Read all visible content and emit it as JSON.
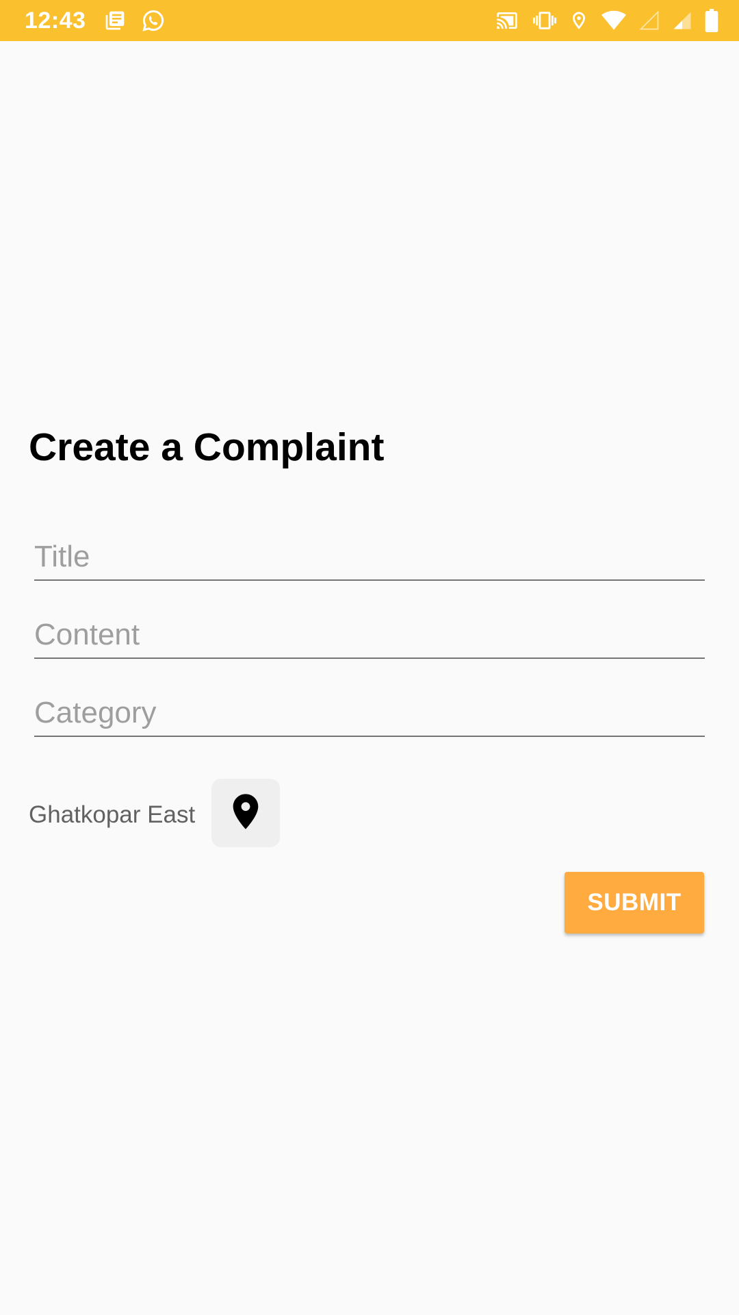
{
  "status_bar": {
    "time": "12:43",
    "background": "#fbc02d",
    "left_icons": [
      "news-icon",
      "whatsapp-icon"
    ],
    "right_icons": [
      "cast-icon",
      "vibrate-icon",
      "location-icon",
      "wifi-icon",
      "signal-icon",
      "signal-icon",
      "battery-icon"
    ]
  },
  "page": {
    "title": "Create a Complaint"
  },
  "form": {
    "title_placeholder": "Title",
    "content_placeholder": "Content",
    "category_placeholder": "Category"
  },
  "location": {
    "label": "Ghatkopar East",
    "icon": "map-pin-icon"
  },
  "actions": {
    "submit_label": "SUBMIT",
    "accent": "#ffab40"
  }
}
